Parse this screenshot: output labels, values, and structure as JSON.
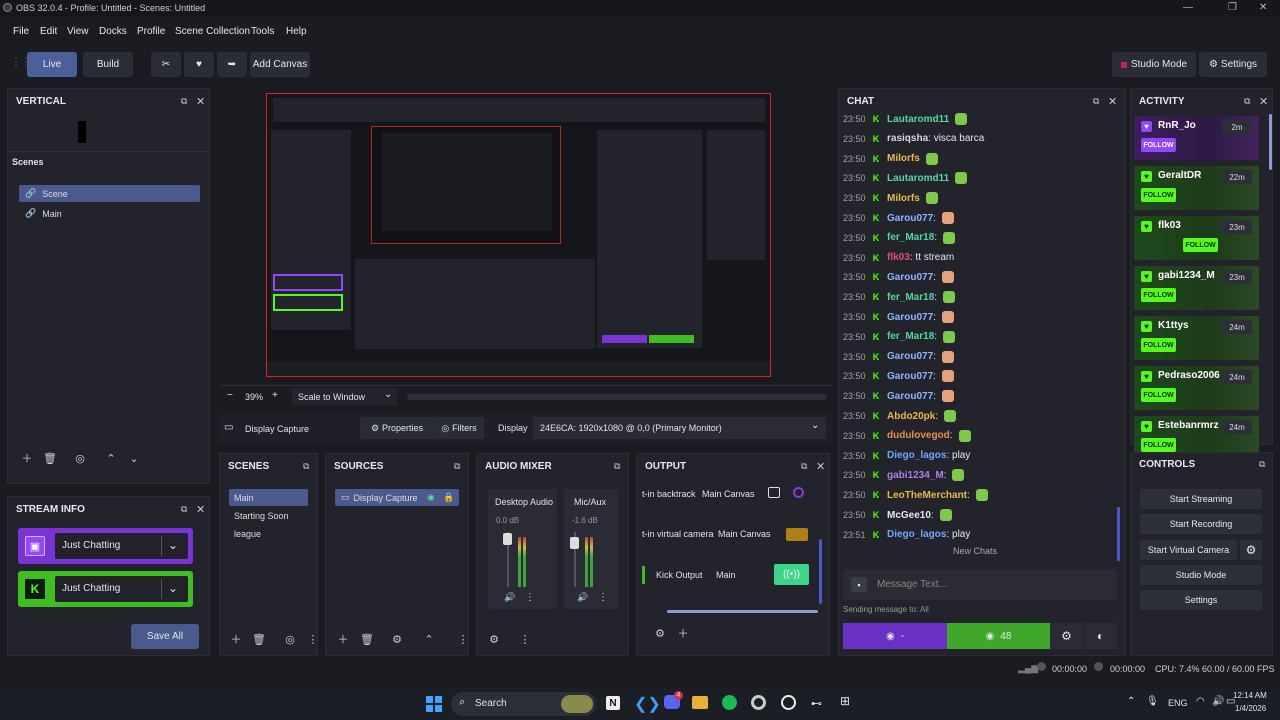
{
  "window": {
    "title": "OBS 32.0.4 - Profile: Untitled - Scenes: Untitled",
    "minimize": "—",
    "maximize": "❐",
    "close": "✕"
  },
  "menu": [
    "File",
    "Edit",
    "View",
    "Docks",
    "Profile",
    "Scene Collection",
    "Tools",
    "Help"
  ],
  "toolbar": {
    "live": "Live",
    "build": "Build",
    "add_canvas": "Add Canvas",
    "studio_mode": "Studio Mode",
    "settings": "Settings"
  },
  "vertical": {
    "title": "VERTICAL"
  },
  "scenes_vertical": {
    "title": "Scenes",
    "items": [
      "Scene",
      "Main"
    ]
  },
  "preview": {
    "zoom": "39%",
    "scale": "Scale to Window",
    "minus": "−",
    "plus": "+"
  },
  "source_bar": {
    "source": "Display Capture",
    "properties": "Properties",
    "filters": "Filters",
    "display_label": "Display",
    "display_value": "24E6CA: 1920x1080 @ 0,0 (Primary Monitor)"
  },
  "scenes": {
    "title": "SCENES",
    "items": [
      "Main",
      "Starting Soon",
      "league"
    ]
  },
  "sources": {
    "title": "SOURCES",
    "items": [
      "Display Capture"
    ]
  },
  "mixer": {
    "title": "AUDIO MIXER",
    "channels": [
      {
        "name": "Desktop Audio",
        "db": "0.0 dB"
      },
      {
        "name": "Mic/Aux",
        "db": "-1.6 dB"
      }
    ]
  },
  "output": {
    "title": "OUTPUT",
    "rows": [
      {
        "name": "t-in backtrack",
        "canvas": "Main Canvas"
      },
      {
        "name": "t-in virtual camera",
        "canvas": "Main Canvas"
      },
      {
        "name": "Kick Output",
        "canvas": "Main"
      }
    ]
  },
  "stream_info": {
    "title": "STREAM INFO",
    "twitch_category": "Just Chatting",
    "kick_category": "Just Chatting",
    "save_all": "Save All"
  },
  "chat": {
    "title": "CHAT",
    "messages": [
      {
        "time": "23:50",
        "user": "Lautaromd11",
        "color": "#4fd8a5",
        "text": ""
      },
      {
        "time": "23:50",
        "user": "rasiqsha",
        "color": "#d8d8e0",
        "text": ": visca barca"
      },
      {
        "time": "23:50",
        "user": "Milorfs",
        "color": "#e8b84a",
        "text": ""
      },
      {
        "time": "23:50",
        "user": "Lautaromd11",
        "color": "#4fd8a5",
        "text": ""
      },
      {
        "time": "23:50",
        "user": "Milorfs",
        "color": "#e8b84a",
        "text": ""
      },
      {
        "time": "23:50",
        "user": "Garou077",
        "color": "#8fb4ff",
        "text": " :"
      },
      {
        "time": "23:50",
        "user": "fer_Mar18",
        "color": "#4fd8a5",
        "text": ":"
      },
      {
        "time": "23:50",
        "user": "flk03",
        "color": "#e0507a",
        "text": ": tt stream"
      },
      {
        "time": "23:50",
        "user": "Garou077",
        "color": "#8fb4ff",
        "text": " :"
      },
      {
        "time": "23:50",
        "user": "fer_Mar18",
        "color": "#4fd8a5",
        "text": ":"
      },
      {
        "time": "23:50",
        "user": "Garou077",
        "color": "#8fb4ff",
        "text": " :"
      },
      {
        "time": "23:50",
        "user": "fer_Mar18",
        "color": "#4fd8a5",
        "text": ":"
      },
      {
        "time": "23:50",
        "user": "Garou077",
        "color": "#8fb4ff",
        "text": " :"
      },
      {
        "time": "23:50",
        "user": "Garou077",
        "color": "#8fb4ff",
        "text": " :"
      },
      {
        "time": "23:50",
        "user": "Garou077",
        "color": "#8fb4ff",
        "text": " :"
      },
      {
        "time": "23:50",
        "user": "Abdo20pk",
        "color": "#e8b84a",
        "text": ":"
      },
      {
        "time": "23:50",
        "user": "dudulovegod",
        "color": "#e8904a",
        "text": ":"
      },
      {
        "time": "23:50",
        "user": "Diego_lagos",
        "color": "#6fa8ff",
        "text": ": play"
      },
      {
        "time": "23:50",
        "user": "gabi1234_M",
        "color": "#b47ce8",
        "text": ":"
      },
      {
        "time": "23:50",
        "user": "LeoTheMerchant",
        "color": "#e8b84a",
        "text": ":"
      },
      {
        "time": "23:50",
        "user": "McGee10",
        "color": "#e8e8ee",
        "text": ":"
      },
      {
        "time": "23:51",
        "user": "Diego_lagos",
        "color": "#6fa8ff",
        "text": ": play"
      }
    ],
    "new_chats": "New Chats",
    "input_placeholder": "Message Text...",
    "sending_to": "Sending message to: All",
    "twitch_viewers": "-",
    "kick_viewers": "48"
  },
  "activity": {
    "title": "ACTIVITY",
    "items": [
      {
        "name": "RnR_Jo",
        "time": "2m",
        "platform": "twitch",
        "button": "FOLLOW"
      },
      {
        "name": "GeraltDR",
        "time": "22m",
        "platform": "kick",
        "button": "FOLLOW"
      },
      {
        "name": "flk03",
        "time": "23m",
        "platform": "kick",
        "button": "FOLLOW"
      },
      {
        "name": "gabi1234_M",
        "time": "23m",
        "platform": "kick",
        "button": "FOLLOW"
      },
      {
        "name": "K1ttys",
        "time": "24m",
        "platform": "kick",
        "button": "FOLLOW"
      },
      {
        "name": "Pedraso2006",
        "time": "24m",
        "platform": "kick",
        "button": "FOLLOW"
      },
      {
        "name": "Estebanrmrz",
        "time": "24m",
        "platform": "kick",
        "button": "FOLLOW"
      }
    ]
  },
  "controls": {
    "title": "CONTROLS",
    "start_streaming": "Start Streaming",
    "start_recording": "Start Recording",
    "start_virtual_camera": "Start Virtual Camera",
    "studio_mode": "Studio Mode",
    "settings": "Settings"
  },
  "statusbar": {
    "stream_time": "00:00:00",
    "rec_time": "00:00:00",
    "cpu": "CPU: 7.4%",
    "fps": "60.00 / 60.00 FPS"
  },
  "taskbar": {
    "search": "Search",
    "lang": "ENG",
    "time": "12:14 AM",
    "date": "1/4/2026",
    "badge": "4"
  }
}
